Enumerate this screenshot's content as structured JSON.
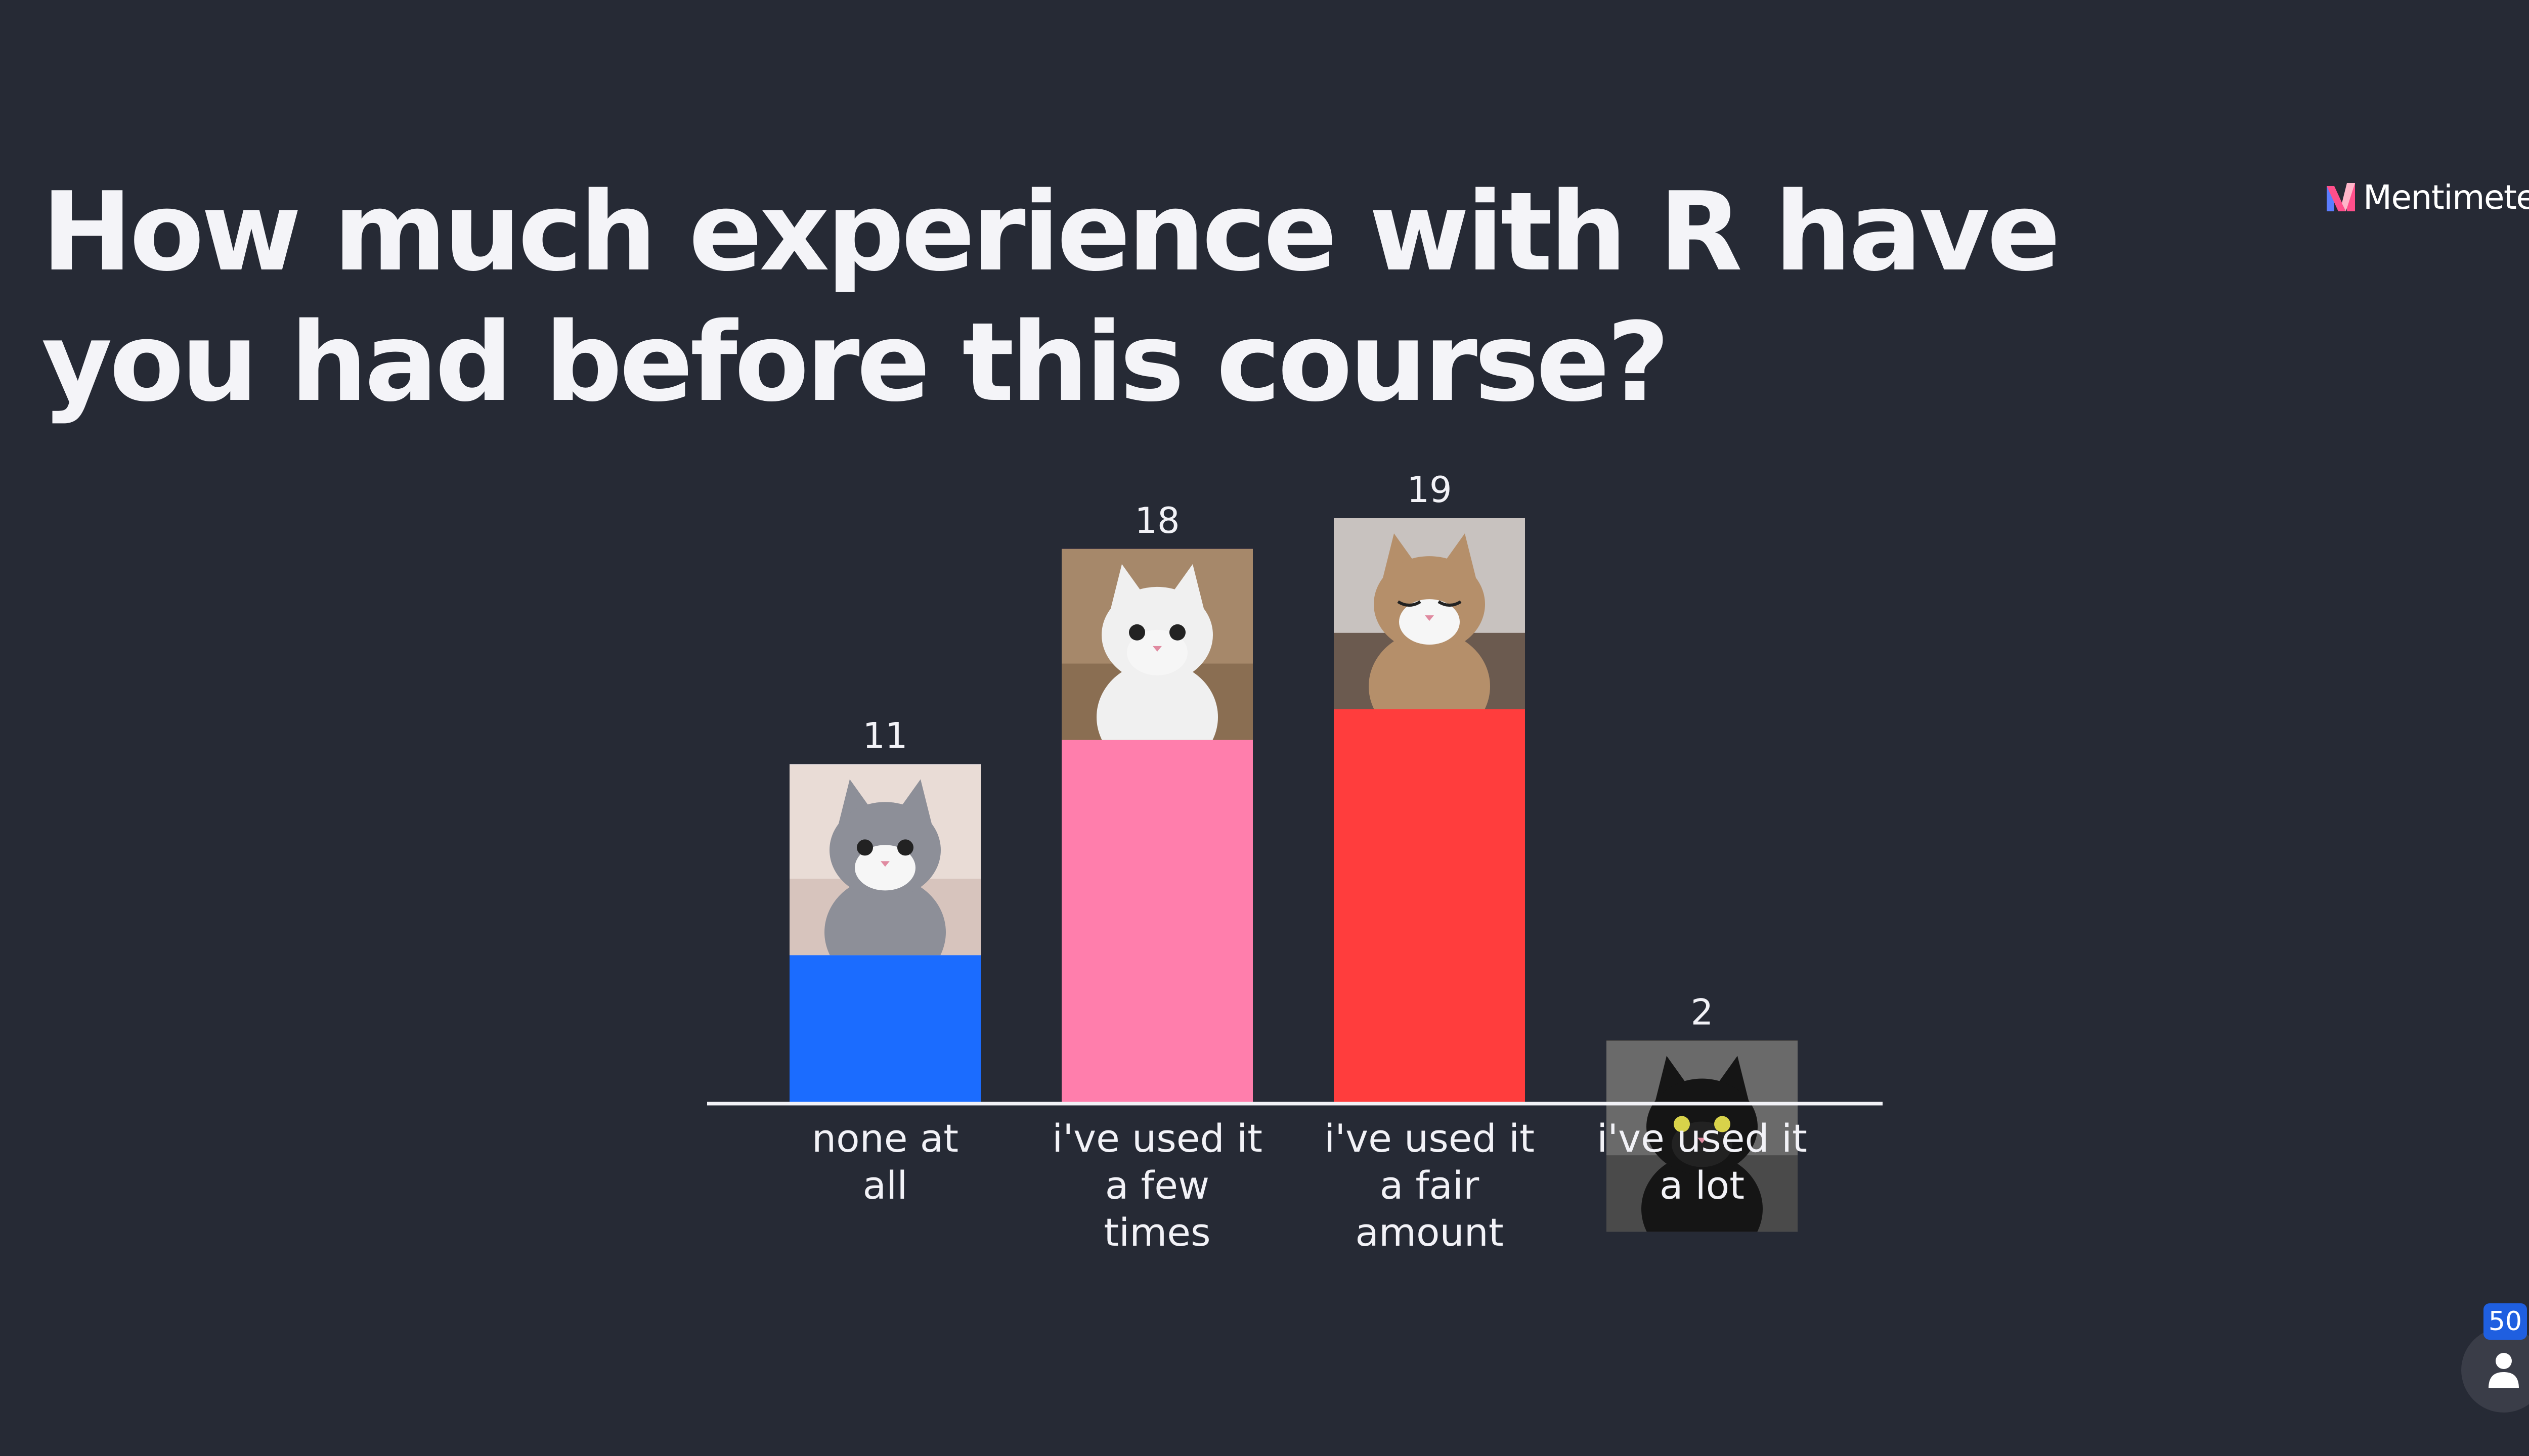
{
  "slide": {
    "question": "How much experience with R have you had before this course?",
    "brand_name": "Mentimeter"
  },
  "participants": {
    "count": "50",
    "icon": "person-icon"
  },
  "chart_data": {
    "type": "bar",
    "categories": [
      [
        "none at",
        "all"
      ],
      [
        "i've used it",
        "a few",
        "times"
      ],
      [
        "i've used it",
        "a fair",
        "amount"
      ],
      [
        "i've used it",
        "a lot"
      ]
    ],
    "values": [
      11,
      18,
      19,
      2
    ],
    "colors": [
      "#1b6cff",
      "#ff7eac",
      "#ff3d3d",
      "#ffc636"
    ],
    "image_themes": [
      "kitten",
      "kitten",
      "kitten",
      "black-cat"
    ],
    "ylim": [
      0,
      19
    ],
    "grid": false,
    "legend": "none"
  }
}
